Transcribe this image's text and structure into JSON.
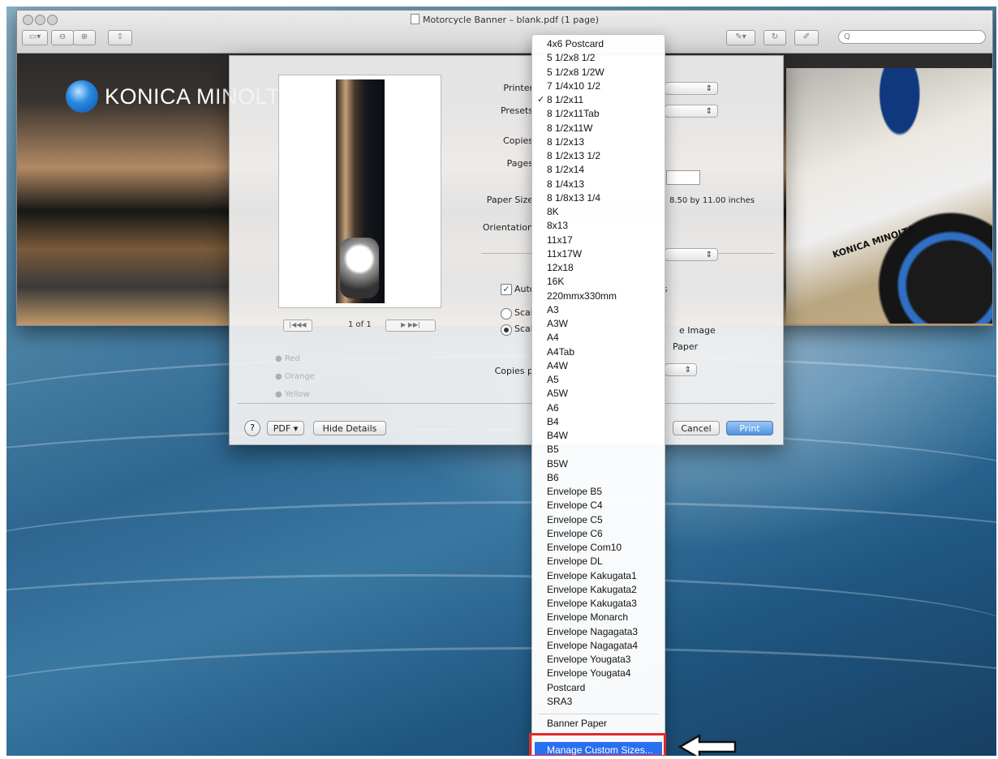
{
  "window": {
    "title": "Motorcycle Banner – blank.pdf (1 page)",
    "search_placeholder": "Q"
  },
  "banner": {
    "logo_text": "KONICA MINOLTA",
    "bike_text": "KONICA MINOLTA"
  },
  "print": {
    "labels": {
      "printer": "Printer",
      "presets": "Presets",
      "copies": "Copies",
      "pages": "Pages",
      "paper_size": "Paper Size",
      "orientation": "Orientation",
      "auto": "Auto",
      "scale": "Scale",
      "scale_to_fit": "Scale",
      "copies_per_page": "Copies p"
    },
    "paper_size_value": "8.50 by 11.00 inches",
    "page_indicator": "1 of 1",
    "pager_first": "|◀◀",
    "pager_prev": "◀",
    "pager_next": "▶",
    "pager_last": "▶▶|",
    "print_image_option": "e Image",
    "paper_option": "Paper",
    "show_notes": "s",
    "help": "?",
    "pdf_button": "PDF ▾",
    "hide_details": "Hide Details",
    "cancel": "Cancel",
    "print_button": "Print",
    "auto_rotate_checked": true
  },
  "menu": {
    "checked_item": "8 1/2x11",
    "items": [
      "4x6 Postcard",
      "5 1/2x8 1/2",
      "5 1/2x8 1/2W",
      "7 1/4x10 1/2",
      "8 1/2x11",
      "8 1/2x11Tab",
      "8 1/2x11W",
      "8 1/2x13",
      "8 1/2x13 1/2",
      "8 1/2x14",
      "8 1/4x13",
      "8 1/8x13 1/4",
      "8K",
      "8x13",
      "11x17",
      "11x17W",
      "12x18",
      "16K",
      "220mmx330mm",
      "A3",
      "A3W",
      "A4",
      "A4Tab",
      "A4W",
      "A5",
      "A5W",
      "A6",
      "B4",
      "B4W",
      "B5",
      "B5W",
      "B6",
      "Envelope B5",
      "Envelope C4",
      "Envelope C5",
      "Envelope C6",
      "Envelope Com10",
      "Envelope DL",
      "Envelope Kakugata1",
      "Envelope Kakugata2",
      "Envelope Kakugata3",
      "Envelope Monarch",
      "Envelope Nagagata3",
      "Envelope Nagagata4",
      "Envelope Yougata3",
      "Envelope Yougata4",
      "Postcard",
      "SRA3"
    ],
    "banner_paper": "Banner Paper",
    "manage_custom_sizes": "Manage Custom Sizes..."
  },
  "colors": {
    "highlight": "#2a6ff0",
    "callout": "#e02a2a"
  }
}
